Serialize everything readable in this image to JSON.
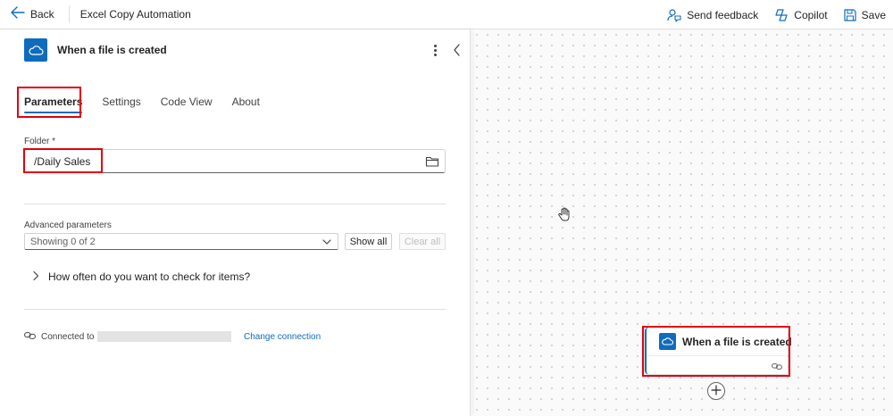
{
  "topbar": {
    "back_label": "Back",
    "flow_title": "Excel Copy Automation",
    "send_feedback_label": "Send feedback",
    "copilot_label": "Copilot",
    "save_label": "Save"
  },
  "panel": {
    "title": "When a file is created",
    "tabs": [
      {
        "label": "Parameters",
        "active": true
      },
      {
        "label": "Settings"
      },
      {
        "label": "Code View"
      },
      {
        "label": "About"
      }
    ],
    "folder": {
      "label": "Folder *",
      "value": "/Daily Sales"
    },
    "advanced": {
      "label": "Advanced parameters",
      "select_value": "Showing 0 of 2",
      "show_all_label": "Show all",
      "clear_all_label": "Clear all"
    },
    "expander_label": "How often do you want to check for items?",
    "connection": {
      "connected_label": "Connected to",
      "change_label": "Change connection"
    }
  },
  "canvas": {
    "node_title": "When a file is created"
  },
  "colors": {
    "accent": "#0f6cbd",
    "highlight": "#e3000f"
  },
  "icons": {
    "trigger": "onedrive-cloud-icon",
    "folder_picker": "folder-icon",
    "connection": "link-icon"
  }
}
